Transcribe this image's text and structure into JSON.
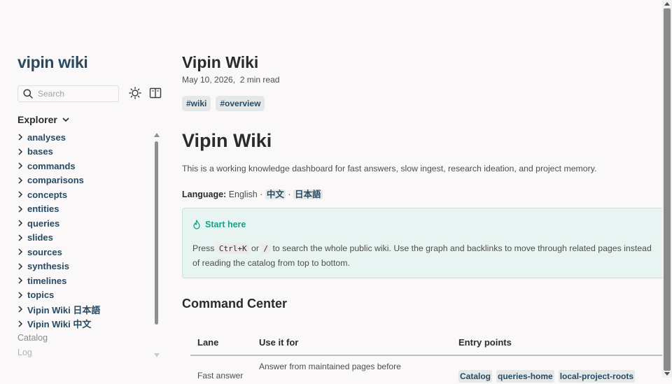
{
  "sidebar": {
    "site_title": "vipin wiki",
    "search_placeholder": "Search",
    "explorer_label": "Explorer",
    "folders": [
      {
        "label": "analyses"
      },
      {
        "label": "bases"
      },
      {
        "label": "commands"
      },
      {
        "label": "comparisons"
      },
      {
        "label": "concepts"
      },
      {
        "label": "entities"
      },
      {
        "label": "queries"
      },
      {
        "label": "slides"
      },
      {
        "label": "sources"
      },
      {
        "label": "synthesis"
      },
      {
        "label": "timelines"
      },
      {
        "label": "topics"
      },
      {
        "label": "Vipin Wiki 日本語"
      },
      {
        "label": "Vipin Wiki 中文"
      }
    ],
    "links": [
      {
        "label": "Catalog"
      },
      {
        "label": "Log"
      }
    ]
  },
  "main": {
    "page_title": "Vipin Wiki",
    "date": "May 10, 2026,",
    "read_time": "2 min read",
    "tags": [
      "#wiki",
      "#overview"
    ],
    "heading": "Vipin Wiki",
    "intro": "This is a working knowledge dashboard for fast answers, slow ingest, research ideation, and project memory.",
    "language": {
      "label": "Language:",
      "current": "English",
      "sep": "·",
      "options": [
        "中文",
        "日本語"
      ]
    },
    "callout": {
      "title": "Start here",
      "text_1": "Press",
      "key_1": "Ctrl+K",
      "text_2": "or",
      "key_2": "/",
      "text_3": "to search the whole public wiki. Use the graph and backlinks to move through related pages instead of reading the catalog from top to bottom."
    },
    "section_title": "Command Center",
    "table": {
      "headers": [
        "Lane",
        "Use it for",
        "Entry points"
      ],
      "rows": [
        {
          "lane": "Fast answer",
          "use": "Answer from maintained pages before",
          "entries": [
            "Catalog",
            "queries-home",
            "local-project-roots"
          ]
        }
      ]
    }
  }
}
